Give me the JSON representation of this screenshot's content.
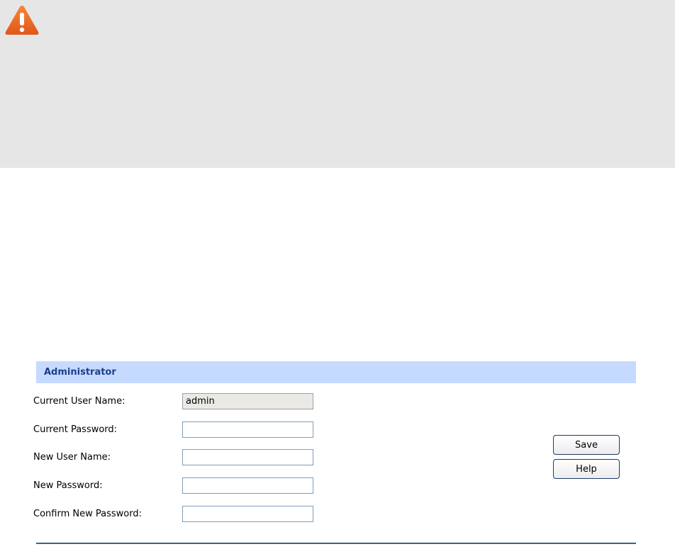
{
  "panel": {
    "title": "Administrator"
  },
  "form": {
    "current_user_name": {
      "label": "Current User Name:",
      "value": "admin"
    },
    "current_password": {
      "label": "Current Password:",
      "value": ""
    },
    "new_user_name": {
      "label": "New User Name:",
      "value": ""
    },
    "new_password": {
      "label": "New Password:",
      "value": ""
    },
    "confirm_new_password": {
      "label": "Confirm New Password:",
      "value": ""
    }
  },
  "buttons": {
    "save": "Save",
    "help": "Help"
  },
  "icons": {
    "warning": "warning-icon"
  },
  "colors": {
    "header_bg": "#c6daff",
    "header_text": "#1c3f8c",
    "warning": "#e8641b"
  }
}
